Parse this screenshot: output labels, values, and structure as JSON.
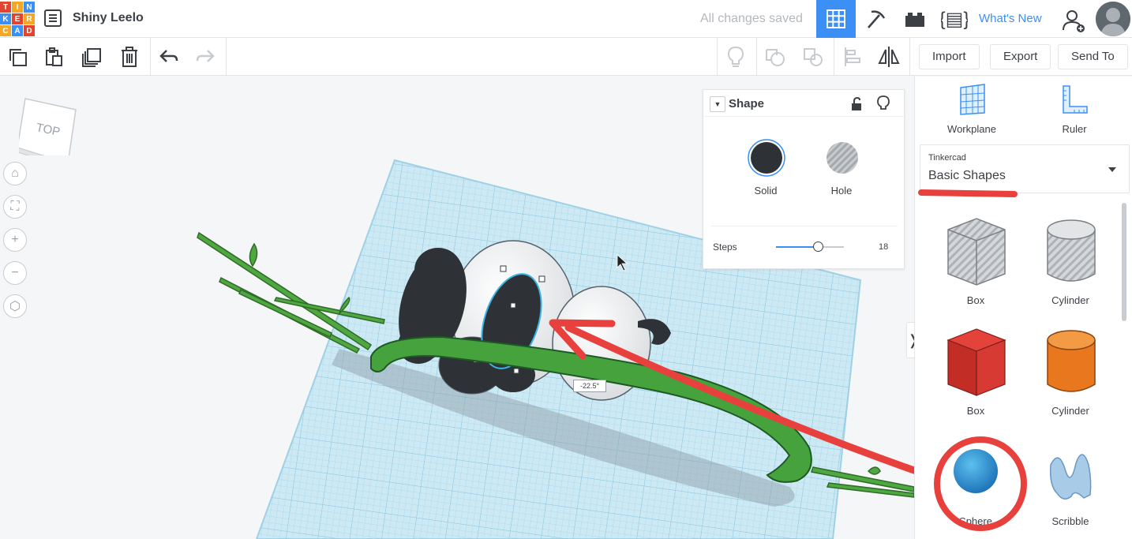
{
  "header": {
    "logo_letters": [
      "T",
      "I",
      "N",
      "K",
      "E",
      "R",
      "C",
      "A",
      "D"
    ],
    "logo_colors": [
      "#e2442f",
      "#f5a623",
      "#3c8ff5",
      "#3c8ff5",
      "#e2442f",
      "#f5a623",
      "#f5a623",
      "#3c8ff5",
      "#e2442f"
    ],
    "project_title": "Shiny Leelo",
    "save_status": "All changes saved",
    "whats_new": "What's New"
  },
  "toolbar": {
    "import_label": "Import",
    "export_label": "Export",
    "send_to_label": "Send To"
  },
  "viewport": {
    "viewcube_label": "TOP",
    "angle_readout": "-22.5°"
  },
  "shape_panel": {
    "title": "Shape",
    "solid_label": "Solid",
    "hole_label": "Hole",
    "steps_label": "Steps",
    "steps_value": "18",
    "steps_fraction": 0.62
  },
  "right_panel": {
    "workplane_label": "Workplane",
    "ruler_label": "Ruler",
    "library_source": "Tinkercad",
    "library_name": "Basic Shapes",
    "shapes": [
      {
        "label": "Box",
        "icon": "box-hole-icon"
      },
      {
        "label": "Cylinder",
        "icon": "cylinder-hole-icon"
      },
      {
        "label": "Box",
        "icon": "box-solid-icon"
      },
      {
        "label": "Cylinder",
        "icon": "cylinder-solid-icon"
      },
      {
        "label": "Sphere",
        "icon": "sphere-icon"
      },
      {
        "label": "Scribble",
        "icon": "scribble-icon"
      }
    ]
  },
  "colors": {
    "accent": "#3c8ff5",
    "annotation_red": "#e8403c",
    "grid_blue": "#a9dcef",
    "bamboo_green": "#3d9b35"
  }
}
